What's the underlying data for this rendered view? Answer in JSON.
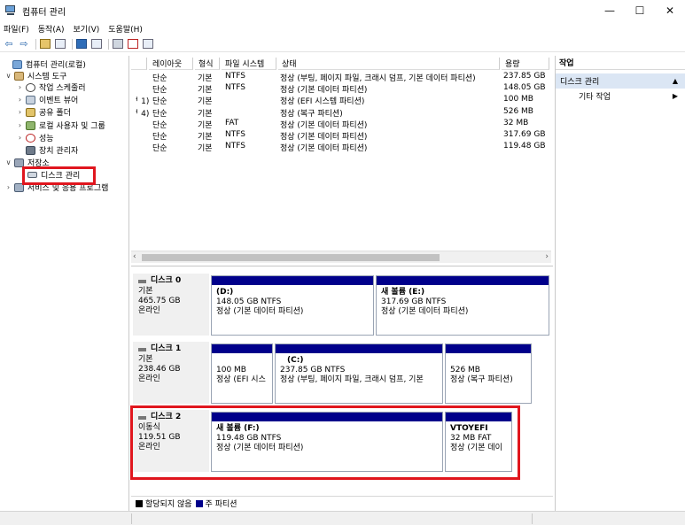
{
  "window": {
    "title": "컴퓨터 관리",
    "minimize": "—",
    "maximize": "☐",
    "close": "✕"
  },
  "menu": [
    "파일(F)",
    "동작(A)",
    "보기(V)",
    "도움말(H)"
  ],
  "toolbar": {
    "back": "⇦",
    "forward": "⇨"
  },
  "tree": [
    {
      "label": "컴퓨터 관리(로컬)",
      "icon": "computer-icon",
      "indent": 0,
      "exp": ""
    },
    {
      "label": "시스템 도구",
      "icon": "tools-icon",
      "indent": 1,
      "exp": "∨"
    },
    {
      "label": "작업 스케줄러",
      "icon": "clock-icon",
      "indent": 2,
      "exp": "›"
    },
    {
      "label": "이벤트 뷰어",
      "icon": "event-icon",
      "indent": 2,
      "exp": "›"
    },
    {
      "label": "공유 폴더",
      "icon": "share-icon",
      "indent": 2,
      "exp": "›"
    },
    {
      "label": "로컬 사용자 및 그룹",
      "icon": "users-icon",
      "indent": 2,
      "exp": "›"
    },
    {
      "label": "성능",
      "icon": "perf-icon",
      "indent": 2,
      "exp": "›"
    },
    {
      "label": "장치 관리자",
      "icon": "device-icon",
      "indent": 2,
      "exp": ""
    },
    {
      "label": "저장소",
      "icon": "storage-icon",
      "indent": 1,
      "exp": "∨"
    },
    {
      "label": "디스크 관리",
      "icon": "disk-icon",
      "indent": 2,
      "exp": ""
    },
    {
      "label": "서비스 및 응용 프로그램",
      "icon": "services-icon",
      "indent": 1,
      "exp": "›"
    }
  ],
  "volume_table": {
    "headers": [
      "레이아웃",
      "형식",
      "파일 시스템",
      "상태",
      "용량"
    ],
    "rows": [
      {
        "prefix": "",
        "layout": "단순",
        "type": "기본",
        "fs": "NTFS",
        "status": "정상 (부팅, 페이지 파일, 크래시 덤프, 기본 데이터 파티션)",
        "capacity": "237.85 GB"
      },
      {
        "prefix": "",
        "layout": "단순",
        "type": "기본",
        "fs": "NTFS",
        "status": "정상 (기본 데이터 파티션)",
        "capacity": "148.05 GB"
      },
      {
        "prefix": "ᅥ 1)",
        "layout": "단순",
        "type": "기본",
        "fs": "",
        "status": "정상 (EFI 시스템 파티션)",
        "capacity": "100 MB"
      },
      {
        "prefix": "ᅥ 4)",
        "layout": "단순",
        "type": "기본",
        "fs": "",
        "status": "정상 (복구 파티션)",
        "capacity": "526 MB"
      },
      {
        "prefix": "",
        "layout": "단순",
        "type": "기본",
        "fs": "FAT",
        "status": "정상 (기본 데이터 파티션)",
        "capacity": "32 MB"
      },
      {
        "prefix": "",
        "layout": "단순",
        "type": "기본",
        "fs": "NTFS",
        "status": "정상 (기본 데이터 파티션)",
        "capacity": "317.69 GB"
      },
      {
        "prefix": "",
        "layout": "단순",
        "type": "기본",
        "fs": "NTFS",
        "status": "정상 (기본 데이터 파티션)",
        "capacity": "119.48 GB"
      }
    ]
  },
  "disks": [
    {
      "name": "디스크 0",
      "kind": "기본",
      "size": "465.75 GB",
      "state": "온라인",
      "partitions": [
        {
          "name": "(D:)",
          "size": "148.05 GB NTFS",
          "status": "정상 (기본 데이터 파티션)"
        },
        {
          "name": "새 볼륨  (E:)",
          "size": "317.69 GB NTFS",
          "status": "정상 (기본 데이터 파티션)"
        }
      ]
    },
    {
      "name": "디스크 1",
      "kind": "기본",
      "size": "238.46 GB",
      "state": "온라인",
      "partitions": [
        {
          "name": "",
          "size": "100 MB",
          "status": "정상 (EFI 시스"
        },
        {
          "name": "(C:)",
          "size": "237.85 GB NTFS",
          "status": "정상 (부팅, 페이지 파일, 크래시 덤프, 기본"
        },
        {
          "name": "",
          "size": "526 MB",
          "status": "정상 (복구 파티션)"
        }
      ]
    },
    {
      "name": "디스크 2",
      "kind": "이동식",
      "size": "119.51 GB",
      "state": "온라인",
      "partitions": [
        {
          "name": "새 볼륨  (F:)",
          "size": "119.48 GB NTFS",
          "status": "정상 (기본 데이터 파티션)"
        },
        {
          "name": "VTOYEFI",
          "size": "32 MB FAT",
          "status": "정상 (기본 데이"
        }
      ]
    }
  ],
  "legend": {
    "unallocated": "할당되지 않음",
    "primary": "주 파티션",
    "unallocated_color": "#000000",
    "primary_color": "#00008b"
  },
  "actions": {
    "header": "작업",
    "section": "디스크 관리",
    "more": "기타 작업"
  }
}
